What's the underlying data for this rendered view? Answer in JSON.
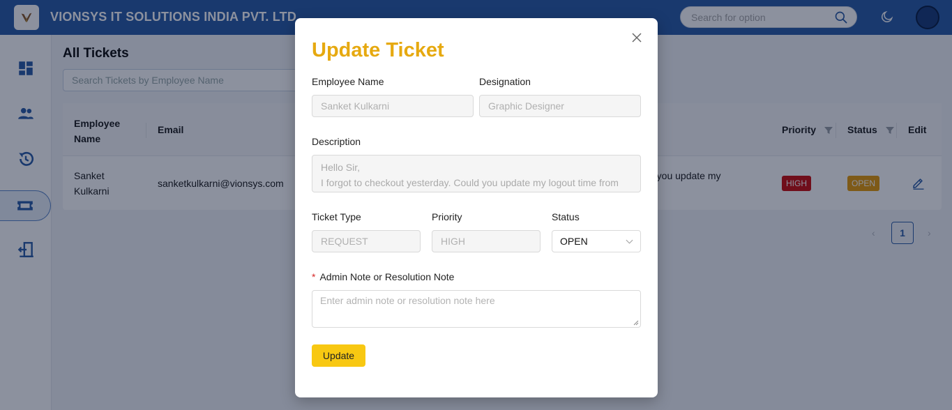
{
  "header": {
    "company": "VIONSYS IT SOLUTIONS INDIA PVT. LTD.",
    "search_placeholder": "Search for option",
    "brand_color": "#2f5fa8"
  },
  "sidebar": {
    "items": [
      {
        "icon": "dashboard-icon",
        "active": false
      },
      {
        "icon": "users-icon",
        "active": false
      },
      {
        "icon": "history-icon",
        "active": false
      },
      {
        "icon": "ticket-icon",
        "active": true
      },
      {
        "icon": "logout-icon",
        "active": false
      }
    ]
  },
  "main": {
    "title": "All Tickets",
    "search_placeholder": "Search Tickets by Employee Name",
    "table": {
      "headers": {
        "employee_name_line1": "Employee",
        "employee_name_line2": "Name",
        "email": "Email",
        "priority": "Priority",
        "status": "Status",
        "edit": "Edit"
      },
      "rows": [
        {
          "name_line1": "Sanket",
          "name_line2": "Kulkarni",
          "email": "sanketkulkarni@vionsys.com",
          "description_fragment": "d you update my",
          "priority": "HIGH",
          "status": "OPEN"
        }
      ]
    },
    "pagination": {
      "prev": "‹",
      "page": "1",
      "next": "›"
    }
  },
  "modal": {
    "title": "Update Ticket",
    "title_color": "#e6a910",
    "employee_name_label": "Employee Name",
    "employee_name_value": "Sanket Kulkarni",
    "designation_label": "Designation",
    "designation_value": "Graphic Designer",
    "description_label": "Description",
    "description_line1": "Hello Sir,",
    "description_line2": "I forgot to checkout yesterday. Could you update my logout time from",
    "ticket_type_label": "Ticket Type",
    "ticket_type_value": "REQUEST",
    "priority_label": "Priority",
    "priority_value": "HIGH",
    "status_label": "Status",
    "status_value": "OPEN",
    "note_required_mark": "*",
    "note_label": "Admin Note or Resolution Note",
    "note_placeholder": "Enter admin note or resolution note here",
    "update_button": "Update"
  }
}
